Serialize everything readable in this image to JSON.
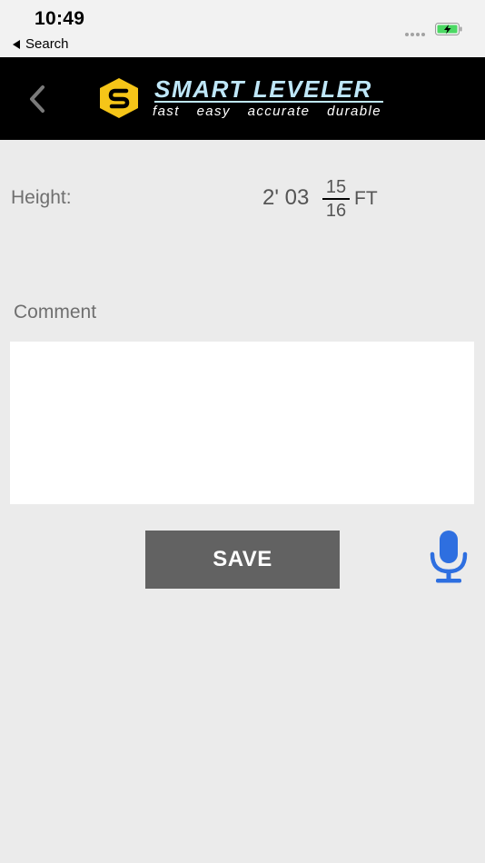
{
  "status_bar": {
    "time": "10:49",
    "back_label": "Search"
  },
  "header": {
    "brand_name": "SMART LEVELER",
    "tagline": [
      "fast",
      "easy",
      "accurate",
      "durable"
    ]
  },
  "measurement": {
    "label": "Height:",
    "value": "2' 03",
    "fraction_numerator": "15",
    "fraction_denominator": "16",
    "unit": "FT"
  },
  "comment": {
    "label": "Comment",
    "value": ""
  },
  "actions": {
    "save_label": "SAVE"
  },
  "colors": {
    "accent_blue": "#2e6fe0",
    "logo_yellow": "#f5c518",
    "save_bg": "#626262",
    "header_bg": "#000000"
  },
  "icons": {
    "back": "chevron-left-icon",
    "mic": "microphone-icon",
    "battery": "battery-charging-icon"
  }
}
